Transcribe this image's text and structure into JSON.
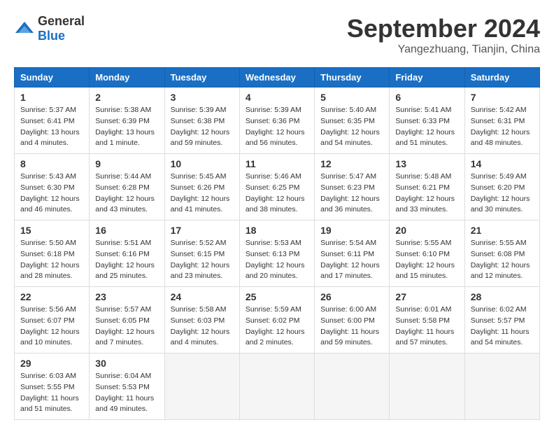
{
  "header": {
    "logo_general": "General",
    "logo_blue": "Blue",
    "month": "September 2024",
    "location": "Yangezhuang, Tianjin, China"
  },
  "columns": [
    "Sunday",
    "Monday",
    "Tuesday",
    "Wednesday",
    "Thursday",
    "Friday",
    "Saturday"
  ],
  "weeks": [
    [
      {
        "day": "1",
        "sunrise": "5:37 AM",
        "sunset": "6:41 PM",
        "daylight": "13 hours and 4 minutes."
      },
      {
        "day": "2",
        "sunrise": "5:38 AM",
        "sunset": "6:39 PM",
        "daylight": "13 hours and 1 minute."
      },
      {
        "day": "3",
        "sunrise": "5:39 AM",
        "sunset": "6:38 PM",
        "daylight": "12 hours and 59 minutes."
      },
      {
        "day": "4",
        "sunrise": "5:39 AM",
        "sunset": "6:36 PM",
        "daylight": "12 hours and 56 minutes."
      },
      {
        "day": "5",
        "sunrise": "5:40 AM",
        "sunset": "6:35 PM",
        "daylight": "12 hours and 54 minutes."
      },
      {
        "day": "6",
        "sunrise": "5:41 AM",
        "sunset": "6:33 PM",
        "daylight": "12 hours and 51 minutes."
      },
      {
        "day": "7",
        "sunrise": "5:42 AM",
        "sunset": "6:31 PM",
        "daylight": "12 hours and 48 minutes."
      }
    ],
    [
      {
        "day": "8",
        "sunrise": "5:43 AM",
        "sunset": "6:30 PM",
        "daylight": "12 hours and 46 minutes."
      },
      {
        "day": "9",
        "sunrise": "5:44 AM",
        "sunset": "6:28 PM",
        "daylight": "12 hours and 43 minutes."
      },
      {
        "day": "10",
        "sunrise": "5:45 AM",
        "sunset": "6:26 PM",
        "daylight": "12 hours and 41 minutes."
      },
      {
        "day": "11",
        "sunrise": "5:46 AM",
        "sunset": "6:25 PM",
        "daylight": "12 hours and 38 minutes."
      },
      {
        "day": "12",
        "sunrise": "5:47 AM",
        "sunset": "6:23 PM",
        "daylight": "12 hours and 36 minutes."
      },
      {
        "day": "13",
        "sunrise": "5:48 AM",
        "sunset": "6:21 PM",
        "daylight": "12 hours and 33 minutes."
      },
      {
        "day": "14",
        "sunrise": "5:49 AM",
        "sunset": "6:20 PM",
        "daylight": "12 hours and 30 minutes."
      }
    ],
    [
      {
        "day": "15",
        "sunrise": "5:50 AM",
        "sunset": "6:18 PM",
        "daylight": "12 hours and 28 minutes."
      },
      {
        "day": "16",
        "sunrise": "5:51 AM",
        "sunset": "6:16 PM",
        "daylight": "12 hours and 25 minutes."
      },
      {
        "day": "17",
        "sunrise": "5:52 AM",
        "sunset": "6:15 PM",
        "daylight": "12 hours and 23 minutes."
      },
      {
        "day": "18",
        "sunrise": "5:53 AM",
        "sunset": "6:13 PM",
        "daylight": "12 hours and 20 minutes."
      },
      {
        "day": "19",
        "sunrise": "5:54 AM",
        "sunset": "6:11 PM",
        "daylight": "12 hours and 17 minutes."
      },
      {
        "day": "20",
        "sunrise": "5:55 AM",
        "sunset": "6:10 PM",
        "daylight": "12 hours and 15 minutes."
      },
      {
        "day": "21",
        "sunrise": "5:55 AM",
        "sunset": "6:08 PM",
        "daylight": "12 hours and 12 minutes."
      }
    ],
    [
      {
        "day": "22",
        "sunrise": "5:56 AM",
        "sunset": "6:07 PM",
        "daylight": "12 hours and 10 minutes."
      },
      {
        "day": "23",
        "sunrise": "5:57 AM",
        "sunset": "6:05 PM",
        "daylight": "12 hours and 7 minutes."
      },
      {
        "day": "24",
        "sunrise": "5:58 AM",
        "sunset": "6:03 PM",
        "daylight": "12 hours and 4 minutes."
      },
      {
        "day": "25",
        "sunrise": "5:59 AM",
        "sunset": "6:02 PM",
        "daylight": "12 hours and 2 minutes."
      },
      {
        "day": "26",
        "sunrise": "6:00 AM",
        "sunset": "6:00 PM",
        "daylight": "11 hours and 59 minutes."
      },
      {
        "day": "27",
        "sunrise": "6:01 AM",
        "sunset": "5:58 PM",
        "daylight": "11 hours and 57 minutes."
      },
      {
        "day": "28",
        "sunrise": "6:02 AM",
        "sunset": "5:57 PM",
        "daylight": "11 hours and 54 minutes."
      }
    ],
    [
      {
        "day": "29",
        "sunrise": "6:03 AM",
        "sunset": "5:55 PM",
        "daylight": "11 hours and 51 minutes."
      },
      {
        "day": "30",
        "sunrise": "6:04 AM",
        "sunset": "5:53 PM",
        "daylight": "11 hours and 49 minutes."
      },
      null,
      null,
      null,
      null,
      null
    ]
  ]
}
